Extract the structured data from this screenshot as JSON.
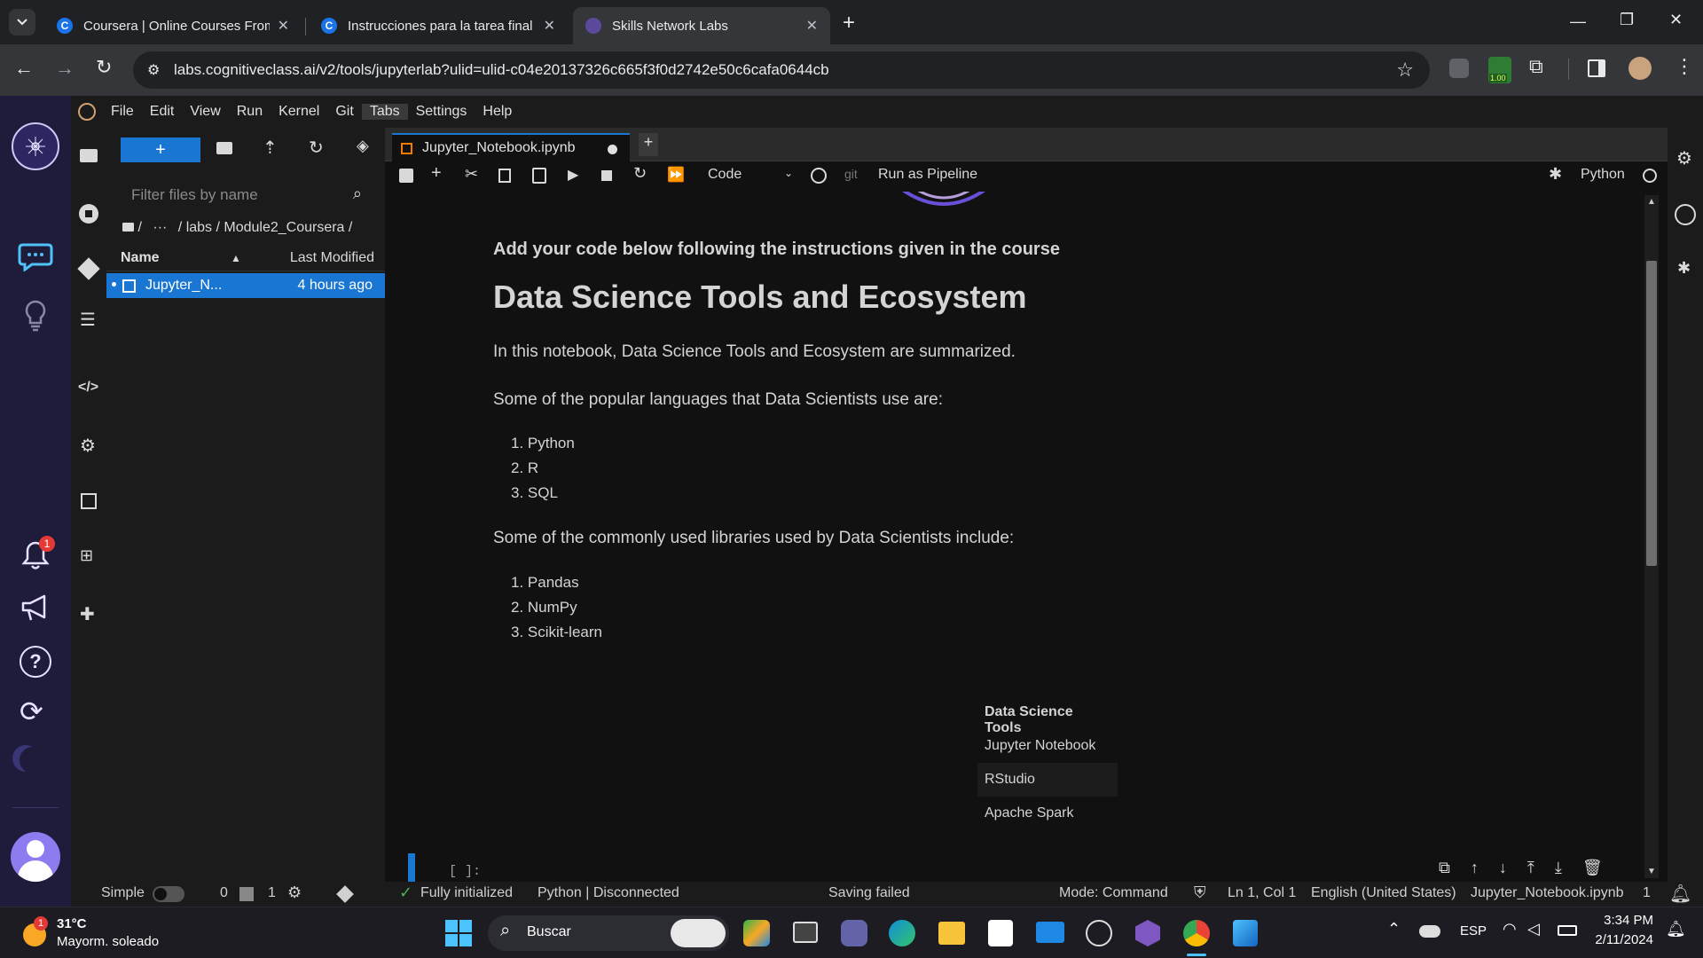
{
  "browser": {
    "tabs": [
      {
        "title": "Coursera | Online Courses From",
        "favicon": "C"
      },
      {
        "title": "Instrucciones para la tarea final",
        "favicon": "C"
      },
      {
        "title": "Skills Network Labs",
        "favicon": "S"
      }
    ],
    "url": "labs.cognitiveclass.ai/v2/tools/jupyterlab?ulid=ulid-c04e20137326c665f3f0d2742e50c6cafa0644cb",
    "extension_badge": "1.00"
  },
  "rail": {
    "notification_count": "1"
  },
  "menu": [
    "File",
    "Edit",
    "View",
    "Run",
    "Kernel",
    "Git",
    "Tabs",
    "Settings",
    "Help"
  ],
  "filebrowser": {
    "new_label": "+",
    "filter_placeholder": "Filter files by name",
    "breadcrumb": [
      "/",
      "···",
      "/ labs / Module2_Coursera /"
    ],
    "col_name": "Name",
    "col_modified": "Last Modified",
    "files": [
      {
        "name": "Jupyter_N...",
        "modified": "4 hours ago"
      }
    ]
  },
  "notebook": {
    "tab_title": "Jupyter_Notebook.ipynb",
    "cell_type": "Code",
    "git_label": "git",
    "run_pipeline": "Run as Pipeline",
    "kernel": "Python",
    "intro": "Add your code below following the instructions given in the course",
    "heading": "Data Science Tools and Ecosystem",
    "summary": "In this notebook, Data Science Tools and Ecosystem are summarized.",
    "languages_intro": "Some of the popular languages that Data Scientists use are:",
    "languages": [
      "Python",
      "R",
      "SQL"
    ],
    "libraries_intro": "Some of the commonly used libraries used by Data Scientists include:",
    "libraries": [
      "Pandas",
      "NumPy",
      "Scikit-learn"
    ],
    "table_header": "Data Science Tools",
    "table_rows": [
      "Jupyter Notebook",
      "RStudio",
      "Apache Spark"
    ],
    "code_prompt": "[ ]:"
  },
  "status": {
    "mode_label": "Simple",
    "count_a": "0",
    "count_b": "1",
    "initialized": "Fully initialized",
    "kernel_state": "Python | Disconnected",
    "saving": "Saving failed",
    "mode": "Mode: Command",
    "position": "Ln 1, Col 1",
    "language": "English (United States)",
    "file": "Jupyter_Notebook.ipynb",
    "line_count": "1"
  },
  "taskbar": {
    "temperature": "31°C",
    "weather": "Mayorm. soleado",
    "weather_badge": "1",
    "search": "Buscar",
    "lang": "ESP",
    "time": "3:34 PM",
    "date": "2/11/2024"
  }
}
